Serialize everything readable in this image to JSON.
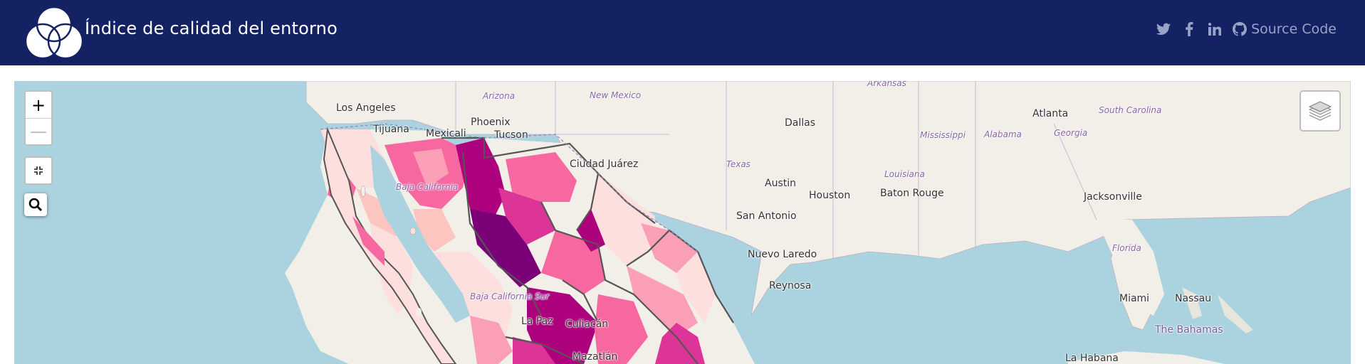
{
  "header": {
    "title": "Índice de calidad del entorno",
    "source_label": "Source Code",
    "icons": [
      "twitter-icon",
      "facebook-icon",
      "linkedin-icon",
      "github-icon"
    ]
  },
  "colors": {
    "navbar": "#142264",
    "water": "#aad3df",
    "land": "#f2efe9",
    "choropleth_low": "#fde0dd",
    "choropleth_mid": "#f768a1",
    "choropleth_high": "#7a0177"
  },
  "map": {
    "controls": {
      "zoom_in": "+",
      "zoom_out": "—"
    },
    "labels": {
      "los_angeles": "Los Angeles",
      "arizona": "Arizona",
      "new_mexico": "New Mexico",
      "arkansas": "Arkansas",
      "phoenix": "Phoenix",
      "tijuana": "Tijuana",
      "mexicali": "Mexicali",
      "tucson": "Tucson",
      "dallas": "Dallas",
      "atlanta": "Atlanta",
      "south_carolina": "South Carolina",
      "mississippi": "Mississippi",
      "alabama": "Alabama",
      "georgia": "Georgia",
      "ciudad_juarez": "Ciudad Juárez",
      "texas": "Texas",
      "austin": "Austin",
      "houston": "Houston",
      "louisiana": "Louisiana",
      "baton_rouge": "Baton Rouge",
      "jacksonville": "Jacksonville",
      "san_antonio": "San Antonio",
      "nuevo_laredo": "Nuevo Laredo",
      "florida": "Florida",
      "reynosa": "Reynosa",
      "miami": "Miami",
      "nassau": "Nassau",
      "the_bahamas": "The Bahamas",
      "baja_california": "Baja California",
      "baja_california_sur": "Baja California Sur",
      "la_paz": "La Paz",
      "culiacan": "Culiacán",
      "mazatlan": "Mazatlán",
      "la_habana": "La Habana"
    }
  }
}
